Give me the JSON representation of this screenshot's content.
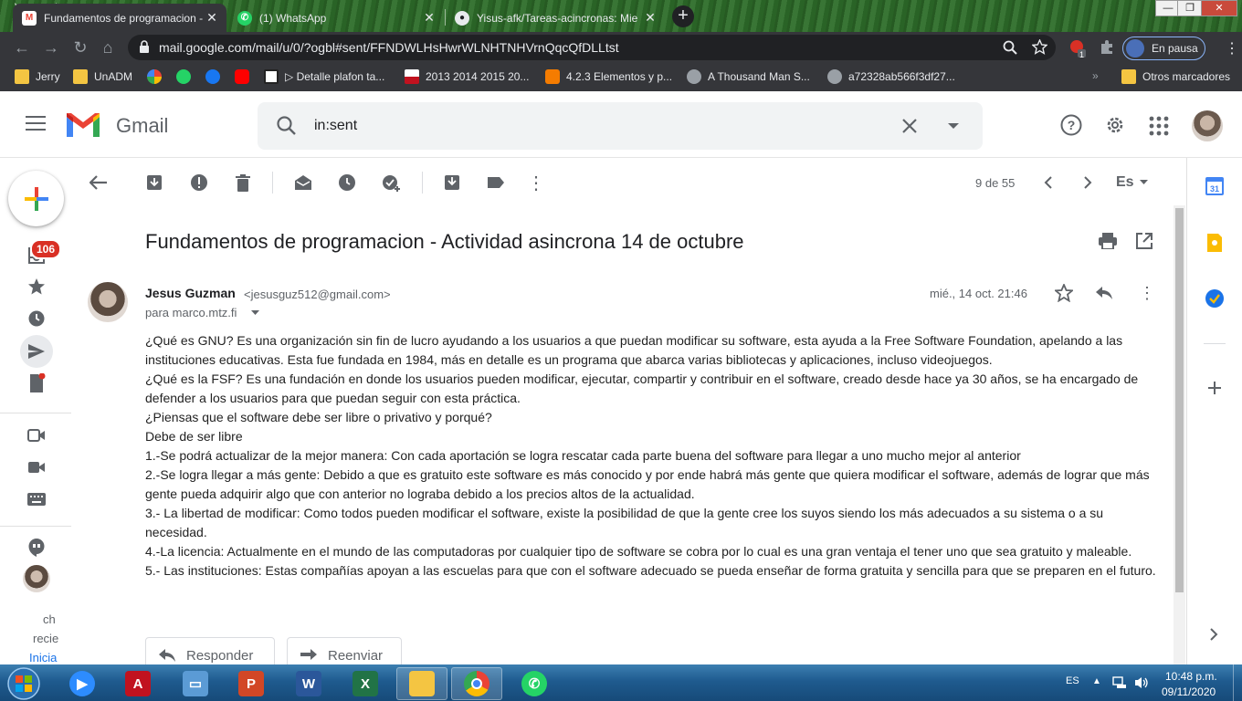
{
  "browser": {
    "tabs": [
      {
        "label": "Fundamentos de programacion -",
        "active": true
      },
      {
        "label": "(1) WhatsApp",
        "active": false
      },
      {
        "label": "Yisus-afk/Tareas-acincronas: Mie",
        "active": false
      }
    ],
    "url": "mail.google.com/mail/u/0/?ogbl#sent/FFNDWLHsHwrWLNHTNHVrnQqcQfDLLtst",
    "paused_label": "En pausa",
    "extension_badge": "1",
    "bookmarks": [
      "Jerry",
      "UnADM",
      "▷ Detalle plafon ta...",
      "2013 2014 2015 20...",
      "4.2.3 Elementos y p...",
      "A Thousand Man S...",
      "a72328ab566f3df27..."
    ],
    "other_bookmarks": "Otros marcadores"
  },
  "gmail": {
    "app_name": "Gmail",
    "search_value": "in:sent",
    "inbox_badge": "106",
    "page_count": "9 de 55",
    "lang": "Es",
    "rail_bottom_texts": [
      "ch",
      "recie",
      "Inicia"
    ]
  },
  "message": {
    "subject": "Fundamentos de programacion - Actividad asincrona 14 de octubre",
    "sender_name": "Jesus Guzman",
    "sender_email": "<jesusguz512@gmail.com>",
    "to": "para marco.mtz.fi",
    "date": "mié., 14 oct. 21:46",
    "body": [
      "¿Qué es GNU? Es una organización sin fin de lucro ayudando a los usuarios a que puedan modificar su software, esta ayuda a la Free Software Foundation, apelando a las instituciones educativas. Esta fue fundada en 1984, más en detalle es un programa que abarca varias bibliotecas y aplicaciones, incluso videojuegos.",
      "¿Qué es la FSF? Es una fundación en donde los usuarios pueden modificar, ejecutar, compartir y contribuir en el software, creado desde hace ya 30 años, se ha encargado de defender a los usuarios para que puedan seguir con esta práctica.",
      "¿Piensas que el software debe ser libre o privativo y porqué?",
      "Debe de ser libre",
      "1.-Se podrá actualizar de la mejor manera: Con cada aportación se logra rescatar cada parte buena del software para llegar a uno mucho mejor al anterior",
      "2.-Se logra llegar a más gente: Debido a que es gratuito este software es más conocido y por ende habrá más gente que quiera modificar el software, además de lograr que más gente pueda adquirir algo que con anterior no lograba debido a los precios altos de la actualidad.",
      "3.- La libertad de modificar: Como todos pueden modificar el software, existe la posibilidad de que la gente cree los suyos siendo los más adecuados a su sistema o a su necesidad.",
      "4.-La licencia: Actualmente en el mundo de las computadoras por cualquier tipo de software se cobra por lo cual es una gran ventaja el tener uno que sea gratuito y maleable.",
      "5.- Las instituciones: Estas compañías apoyan a las escuelas para que con el software adecuado se pueda enseñar de forma gratuita y sencilla para que se preparen en el futuro."
    ],
    "reply_label": "Responder",
    "forward_label": "Reenviar"
  },
  "taskbar": {
    "lang": "ES",
    "time": "10:48 p.m.",
    "date": "09/11/2020"
  },
  "colors": {
    "gmail_red": "#ea4335",
    "chrome_dark": "#35363a",
    "taskbar_blue": "#1f5b8f"
  }
}
